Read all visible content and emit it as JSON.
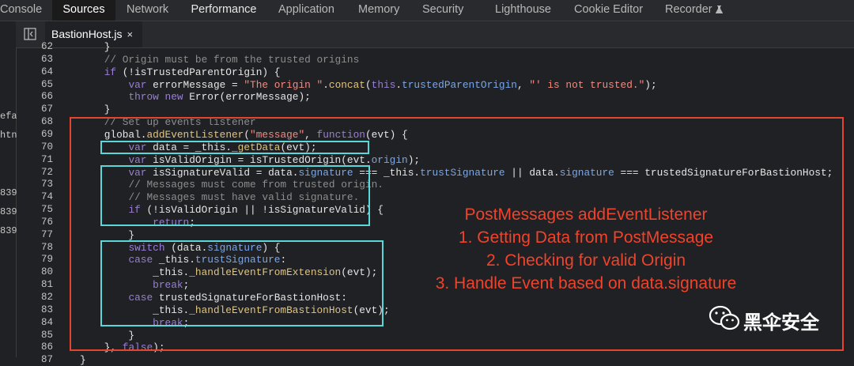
{
  "devtools_tabs": [
    {
      "label": "Console",
      "active": false
    },
    {
      "label": "Sources",
      "active": true
    },
    {
      "label": "Network",
      "active": false
    },
    {
      "label": "Performance",
      "active": false
    },
    {
      "label": "Application",
      "active": false
    },
    {
      "label": "Memory",
      "active": false
    },
    {
      "label": "Security",
      "active": false
    },
    {
      "label": "Lighthouse",
      "active": false
    },
    {
      "label": "Cookie Editor",
      "active": false
    },
    {
      "label": "Recorder",
      "active": false
    }
  ],
  "left_panel_fragments": [
    "efa",
    "htn",
    "839",
    "839",
    "839"
  ],
  "file_tab": {
    "name": "BastionHost.js",
    "close": "×"
  },
  "code": {
    "line_numbers": [
      "62",
      "63",
      "64",
      "65",
      "66",
      "67",
      "68",
      "69",
      "70",
      "71",
      "72",
      "73",
      "74",
      "75",
      "76",
      "77",
      "78",
      "79",
      "80",
      "81",
      "82",
      "83",
      "84",
      "85",
      "86",
      "87"
    ],
    "lines": [
      "    }",
      "    // Origin must be from the trusted origins",
      "    if (!isTrustedParentOrigin) {",
      "        var errorMessage = \"The origin \".concat(this.trustedParentOrigin, \"' is not trusted.\");",
      "        throw new Error(errorMessage);",
      "    }",
      "    // Set up events listener",
      "    global.addEventListener(\"message\", function(evt) {",
      "        var data = _this._getData(evt);",
      "        var isValidOrigin = isTrustedOrigin(evt.origin);",
      "        var isSignatureValid = data.signature === _this.trustSignature || data.signature === trustedSignatureForBastionHost;",
      "        // Messages must come from trusted origin.",
      "        // Messages must have valid signature.",
      "        if (!isValidOrigin || !isSignatureValid) {",
      "            return;",
      "        }",
      "        switch (data.signature) {",
      "        case _this.trustSignature:",
      "            _this._handleEventFromExtension(evt);",
      "            break;",
      "        case trustedSignatureForBastionHost:",
      "            _this._handleEventFromBastionHost(evt);",
      "            break;",
      "        }",
      "    }, false);",
      "}"
    ]
  },
  "annotations": {
    "title": "PostMessages addEventListener",
    "step1": "1. Getting Data from PostMessage",
    "step2": "2. Checking for valid Origin",
    "step3": "3. Handle Event based on data.signature"
  },
  "watermark": {
    "text": "黑伞安全",
    "icon": "wechat-icon"
  },
  "colors": {
    "highlight_red": "#e44530",
    "highlight_cyan": "#5bd7d7",
    "annotation_text": "#f0432b"
  }
}
